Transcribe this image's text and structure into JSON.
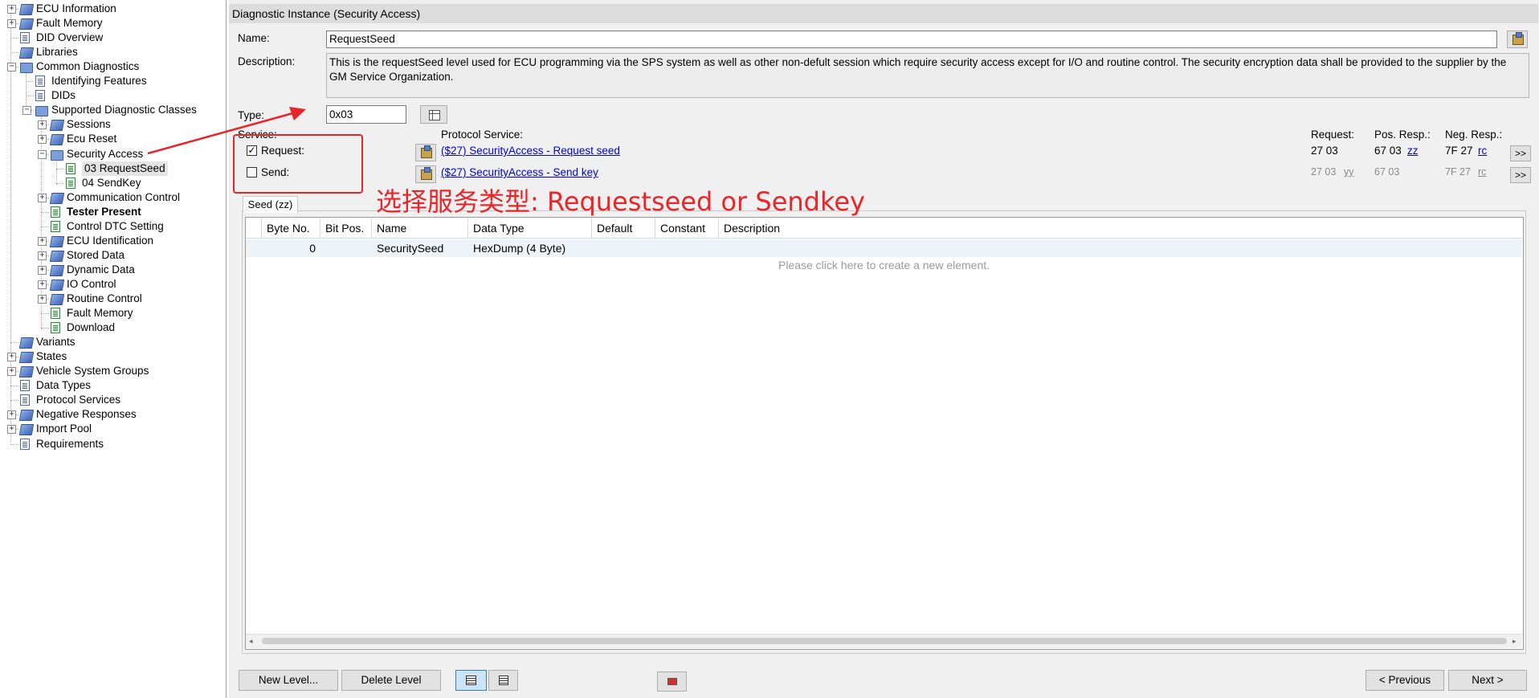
{
  "tree": {
    "items": [
      {
        "label": "ECU Information",
        "level": 0,
        "toggle": "+",
        "icon": "stack"
      },
      {
        "label": "Fault Memory",
        "level": 0,
        "toggle": "+",
        "icon": "stack"
      },
      {
        "label": "DID Overview",
        "level": 0,
        "toggle": "",
        "icon": "doc"
      },
      {
        "label": "Libraries",
        "level": 0,
        "toggle": "",
        "icon": "stack"
      },
      {
        "label": "Common Diagnostics",
        "level": 0,
        "toggle": "-",
        "icon": "folder"
      },
      {
        "label": "Identifying Features",
        "level": 1,
        "toggle": "",
        "icon": "doc"
      },
      {
        "label": "DIDs",
        "level": 1,
        "toggle": "",
        "icon": "doc"
      },
      {
        "label": "Supported Diagnostic Classes",
        "level": 1,
        "toggle": "-",
        "icon": "folder"
      },
      {
        "label": "Sessions",
        "level": 2,
        "toggle": "+",
        "icon": "stack"
      },
      {
        "label": "Ecu Reset",
        "level": 2,
        "toggle": "+",
        "icon": "stack"
      },
      {
        "label": "Security Access",
        "level": 2,
        "toggle": "-",
        "icon": "folder"
      },
      {
        "label": "03 RequestSeed",
        "level": 3,
        "toggle": "",
        "icon": "docg",
        "selected": true
      },
      {
        "label": "04 SendKey",
        "level": 3,
        "toggle": "",
        "icon": "docg"
      },
      {
        "label": "Communication Control",
        "level": 2,
        "toggle": "+",
        "icon": "stack"
      },
      {
        "label": "Tester Present",
        "level": 2,
        "toggle": "",
        "icon": "docg",
        "bold": true
      },
      {
        "label": "Control DTC Setting",
        "level": 2,
        "toggle": "",
        "icon": "docg"
      },
      {
        "label": "ECU Identification",
        "level": 2,
        "toggle": "+",
        "icon": "stack"
      },
      {
        "label": "Stored Data",
        "level": 2,
        "toggle": "+",
        "icon": "stack"
      },
      {
        "label": "Dynamic Data",
        "level": 2,
        "toggle": "+",
        "icon": "stack"
      },
      {
        "label": "IO Control",
        "level": 2,
        "toggle": "+",
        "icon": "stack"
      },
      {
        "label": "Routine Control",
        "level": 2,
        "toggle": "+",
        "icon": "stack"
      },
      {
        "label": "Fault Memory",
        "level": 2,
        "toggle": "",
        "icon": "docg"
      },
      {
        "label": "Download",
        "level": 2,
        "toggle": "",
        "icon": "docg"
      },
      {
        "label": "Variants",
        "level": 0,
        "toggle": "",
        "icon": "stack"
      },
      {
        "label": "States",
        "level": 0,
        "toggle": "+",
        "icon": "stack"
      },
      {
        "label": "Vehicle System Groups",
        "level": 0,
        "toggle": "+",
        "icon": "stack"
      },
      {
        "label": "Data Types",
        "level": 0,
        "toggle": "",
        "icon": "doc"
      },
      {
        "label": "Protocol Services",
        "level": 0,
        "toggle": "",
        "icon": "doc"
      },
      {
        "label": "Negative Responses",
        "level": 0,
        "toggle": "+",
        "icon": "stack"
      },
      {
        "label": "Import Pool",
        "level": 0,
        "toggle": "+",
        "icon": "stack"
      },
      {
        "label": "Requirements",
        "level": 0,
        "toggle": "",
        "icon": "doc"
      }
    ]
  },
  "panel": {
    "title": "Diagnostic Instance (Security Access)",
    "name_label": "Name:",
    "name_value": "RequestSeed",
    "description_label": "Description:",
    "description_value": "This is the requestSeed level used for ECU programming via the SPS system as well as other non-defult session which require security access except for I/O and routine control. The security encryption data shall be provided to the supplier by the GM Service Organization.",
    "type_label": "Type:",
    "type_value": "0x03",
    "service_label": "Service:",
    "protocol_service_label": "Protocol Service:",
    "request_col_label": "Request:",
    "pos_resp_label": "Pos. Resp.:",
    "neg_resp_label": "Neg. Resp.:",
    "services": [
      {
        "label": "Request:",
        "checked": true,
        "check_glyph": "✓",
        "link": "($27) SecurityAccess - Request seed",
        "request": "27 03",
        "pos_prefix": "67 03",
        "pos_link": "zz",
        "neg_prefix": "7F 27",
        "neg_link": "rc",
        "more": ">>",
        "enabled": true
      },
      {
        "label": "Send:",
        "checked": false,
        "check_glyph": "",
        "link": "($27) SecurityAccess - Send key",
        "request": "27 03",
        "request_link": "yy",
        "pos_prefix": "67 03",
        "neg_prefix": "7F 27",
        "neg_link": "rc",
        "more": ">>",
        "enabled": false
      }
    ],
    "tab_label": "Seed (zz)",
    "columns": [
      "Byte No.",
      "Bit Pos.",
      "Name",
      "Data Type",
      "Default",
      "Constant",
      "Description"
    ],
    "rows": [
      {
        "byte_no": "0",
        "bit_pos": "",
        "name": "SecuritySeed",
        "data_type": "HexDump (4 Byte)",
        "default": "",
        "constant": "",
        "description": ""
      }
    ],
    "create_hint": "Please click here to create a new element.",
    "buttons": {
      "new_level": "New Level...",
      "delete_level": "Delete Level",
      "previous": "< Previous",
      "next": "Next >"
    }
  },
  "annotation": {
    "text": "选择服务类型: Requestseed or Sendkey",
    "color": "#e8262a"
  }
}
